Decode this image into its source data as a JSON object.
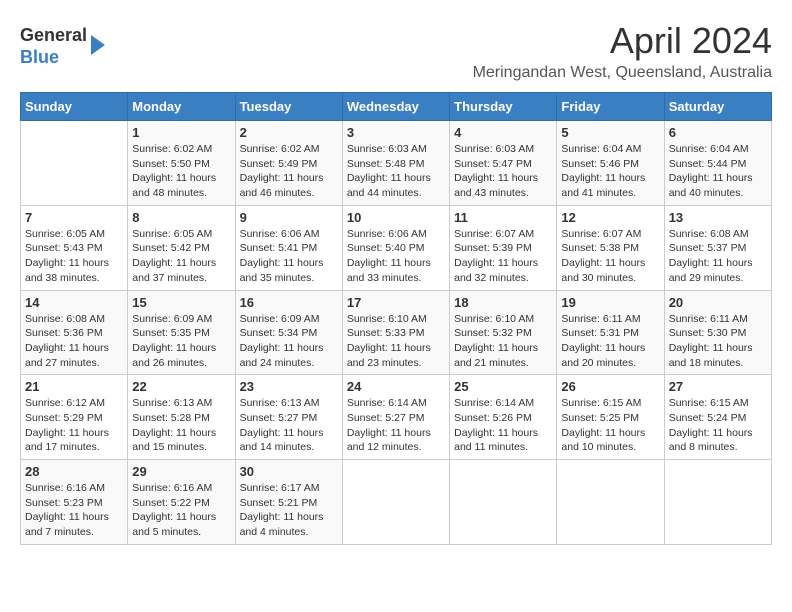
{
  "logo": {
    "line1": "General",
    "line2": "Blue"
  },
  "title": "April 2024",
  "location": "Meringandan West, Queensland, Australia",
  "weekdays": [
    "Sunday",
    "Monday",
    "Tuesday",
    "Wednesday",
    "Thursday",
    "Friday",
    "Saturday"
  ],
  "weeks": [
    [
      {
        "day": "",
        "info": ""
      },
      {
        "day": "1",
        "info": "Sunrise: 6:02 AM\nSunset: 5:50 PM\nDaylight: 11 hours\nand 48 minutes."
      },
      {
        "day": "2",
        "info": "Sunrise: 6:02 AM\nSunset: 5:49 PM\nDaylight: 11 hours\nand 46 minutes."
      },
      {
        "day": "3",
        "info": "Sunrise: 6:03 AM\nSunset: 5:48 PM\nDaylight: 11 hours\nand 44 minutes."
      },
      {
        "day": "4",
        "info": "Sunrise: 6:03 AM\nSunset: 5:47 PM\nDaylight: 11 hours\nand 43 minutes."
      },
      {
        "day": "5",
        "info": "Sunrise: 6:04 AM\nSunset: 5:46 PM\nDaylight: 11 hours\nand 41 minutes."
      },
      {
        "day": "6",
        "info": "Sunrise: 6:04 AM\nSunset: 5:44 PM\nDaylight: 11 hours\nand 40 minutes."
      }
    ],
    [
      {
        "day": "7",
        "info": "Sunrise: 6:05 AM\nSunset: 5:43 PM\nDaylight: 11 hours\nand 38 minutes."
      },
      {
        "day": "8",
        "info": "Sunrise: 6:05 AM\nSunset: 5:42 PM\nDaylight: 11 hours\nand 37 minutes."
      },
      {
        "day": "9",
        "info": "Sunrise: 6:06 AM\nSunset: 5:41 PM\nDaylight: 11 hours\nand 35 minutes."
      },
      {
        "day": "10",
        "info": "Sunrise: 6:06 AM\nSunset: 5:40 PM\nDaylight: 11 hours\nand 33 minutes."
      },
      {
        "day": "11",
        "info": "Sunrise: 6:07 AM\nSunset: 5:39 PM\nDaylight: 11 hours\nand 32 minutes."
      },
      {
        "day": "12",
        "info": "Sunrise: 6:07 AM\nSunset: 5:38 PM\nDaylight: 11 hours\nand 30 minutes."
      },
      {
        "day": "13",
        "info": "Sunrise: 6:08 AM\nSunset: 5:37 PM\nDaylight: 11 hours\nand 29 minutes."
      }
    ],
    [
      {
        "day": "14",
        "info": "Sunrise: 6:08 AM\nSunset: 5:36 PM\nDaylight: 11 hours\nand 27 minutes."
      },
      {
        "day": "15",
        "info": "Sunrise: 6:09 AM\nSunset: 5:35 PM\nDaylight: 11 hours\nand 26 minutes."
      },
      {
        "day": "16",
        "info": "Sunrise: 6:09 AM\nSunset: 5:34 PM\nDaylight: 11 hours\nand 24 minutes."
      },
      {
        "day": "17",
        "info": "Sunrise: 6:10 AM\nSunset: 5:33 PM\nDaylight: 11 hours\nand 23 minutes."
      },
      {
        "day": "18",
        "info": "Sunrise: 6:10 AM\nSunset: 5:32 PM\nDaylight: 11 hours\nand 21 minutes."
      },
      {
        "day": "19",
        "info": "Sunrise: 6:11 AM\nSunset: 5:31 PM\nDaylight: 11 hours\nand 20 minutes."
      },
      {
        "day": "20",
        "info": "Sunrise: 6:11 AM\nSunset: 5:30 PM\nDaylight: 11 hours\nand 18 minutes."
      }
    ],
    [
      {
        "day": "21",
        "info": "Sunrise: 6:12 AM\nSunset: 5:29 PM\nDaylight: 11 hours\nand 17 minutes."
      },
      {
        "day": "22",
        "info": "Sunrise: 6:13 AM\nSunset: 5:28 PM\nDaylight: 11 hours\nand 15 minutes."
      },
      {
        "day": "23",
        "info": "Sunrise: 6:13 AM\nSunset: 5:27 PM\nDaylight: 11 hours\nand 14 minutes."
      },
      {
        "day": "24",
        "info": "Sunrise: 6:14 AM\nSunset: 5:27 PM\nDaylight: 11 hours\nand 12 minutes."
      },
      {
        "day": "25",
        "info": "Sunrise: 6:14 AM\nSunset: 5:26 PM\nDaylight: 11 hours\nand 11 minutes."
      },
      {
        "day": "26",
        "info": "Sunrise: 6:15 AM\nSunset: 5:25 PM\nDaylight: 11 hours\nand 10 minutes."
      },
      {
        "day": "27",
        "info": "Sunrise: 6:15 AM\nSunset: 5:24 PM\nDaylight: 11 hours\nand 8 minutes."
      }
    ],
    [
      {
        "day": "28",
        "info": "Sunrise: 6:16 AM\nSunset: 5:23 PM\nDaylight: 11 hours\nand 7 minutes."
      },
      {
        "day": "29",
        "info": "Sunrise: 6:16 AM\nSunset: 5:22 PM\nDaylight: 11 hours\nand 5 minutes."
      },
      {
        "day": "30",
        "info": "Sunrise: 6:17 AM\nSunset: 5:21 PM\nDaylight: 11 hours\nand 4 minutes."
      },
      {
        "day": "",
        "info": ""
      },
      {
        "day": "",
        "info": ""
      },
      {
        "day": "",
        "info": ""
      },
      {
        "day": "",
        "info": ""
      }
    ]
  ]
}
